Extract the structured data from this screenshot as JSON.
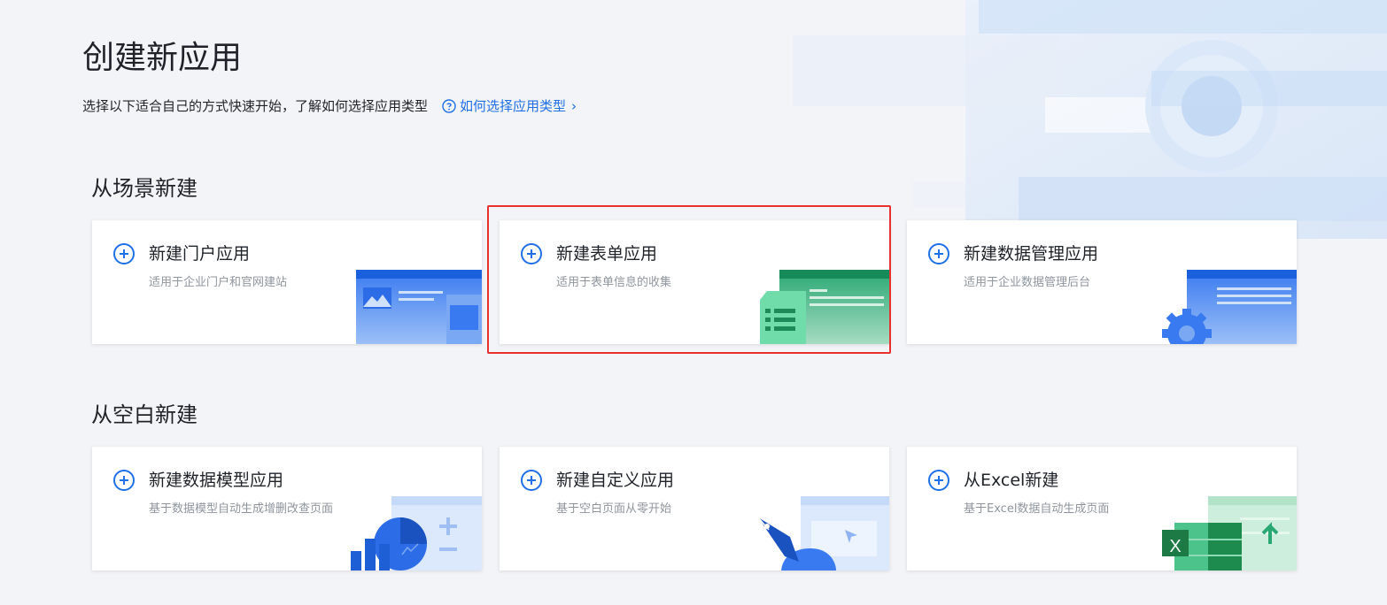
{
  "header": {
    "title": "创建新应用",
    "subtitle": "选择以下适合自己的方式快速开始，了解如何选择应用类型",
    "help_link": "如何选择应用类型",
    "help_chevron": "›"
  },
  "sections": [
    {
      "title": "从场景新建",
      "cards": [
        {
          "title": "新建门户应用",
          "desc": "适用于企业门户和官网建站",
          "icon": "portal-illustration"
        },
        {
          "title": "新建表单应用",
          "desc": "适用于表单信息的收集",
          "icon": "form-illustration",
          "highlighted": true
        },
        {
          "title": "新建数据管理应用",
          "desc": "适用于企业数据管理后台",
          "icon": "data-management-illustration"
        }
      ]
    },
    {
      "title": "从空白新建",
      "cards": [
        {
          "title": "新建数据模型应用",
          "desc": "基于数据模型自动生成增删改查页面",
          "icon": "data-model-illustration"
        },
        {
          "title": "新建自定义应用",
          "desc": "基于空白页面从零开始",
          "icon": "custom-app-illustration"
        },
        {
          "title": "从Excel新建",
          "desc": "基于Excel数据自动生成页面",
          "icon": "excel-illustration",
          "badge": "X"
        }
      ]
    }
  ],
  "colors": {
    "accent": "#1f6fe5",
    "highlight_border": "#e8302d",
    "green": "#22a06b",
    "excel_green": "#1d8a4e"
  }
}
